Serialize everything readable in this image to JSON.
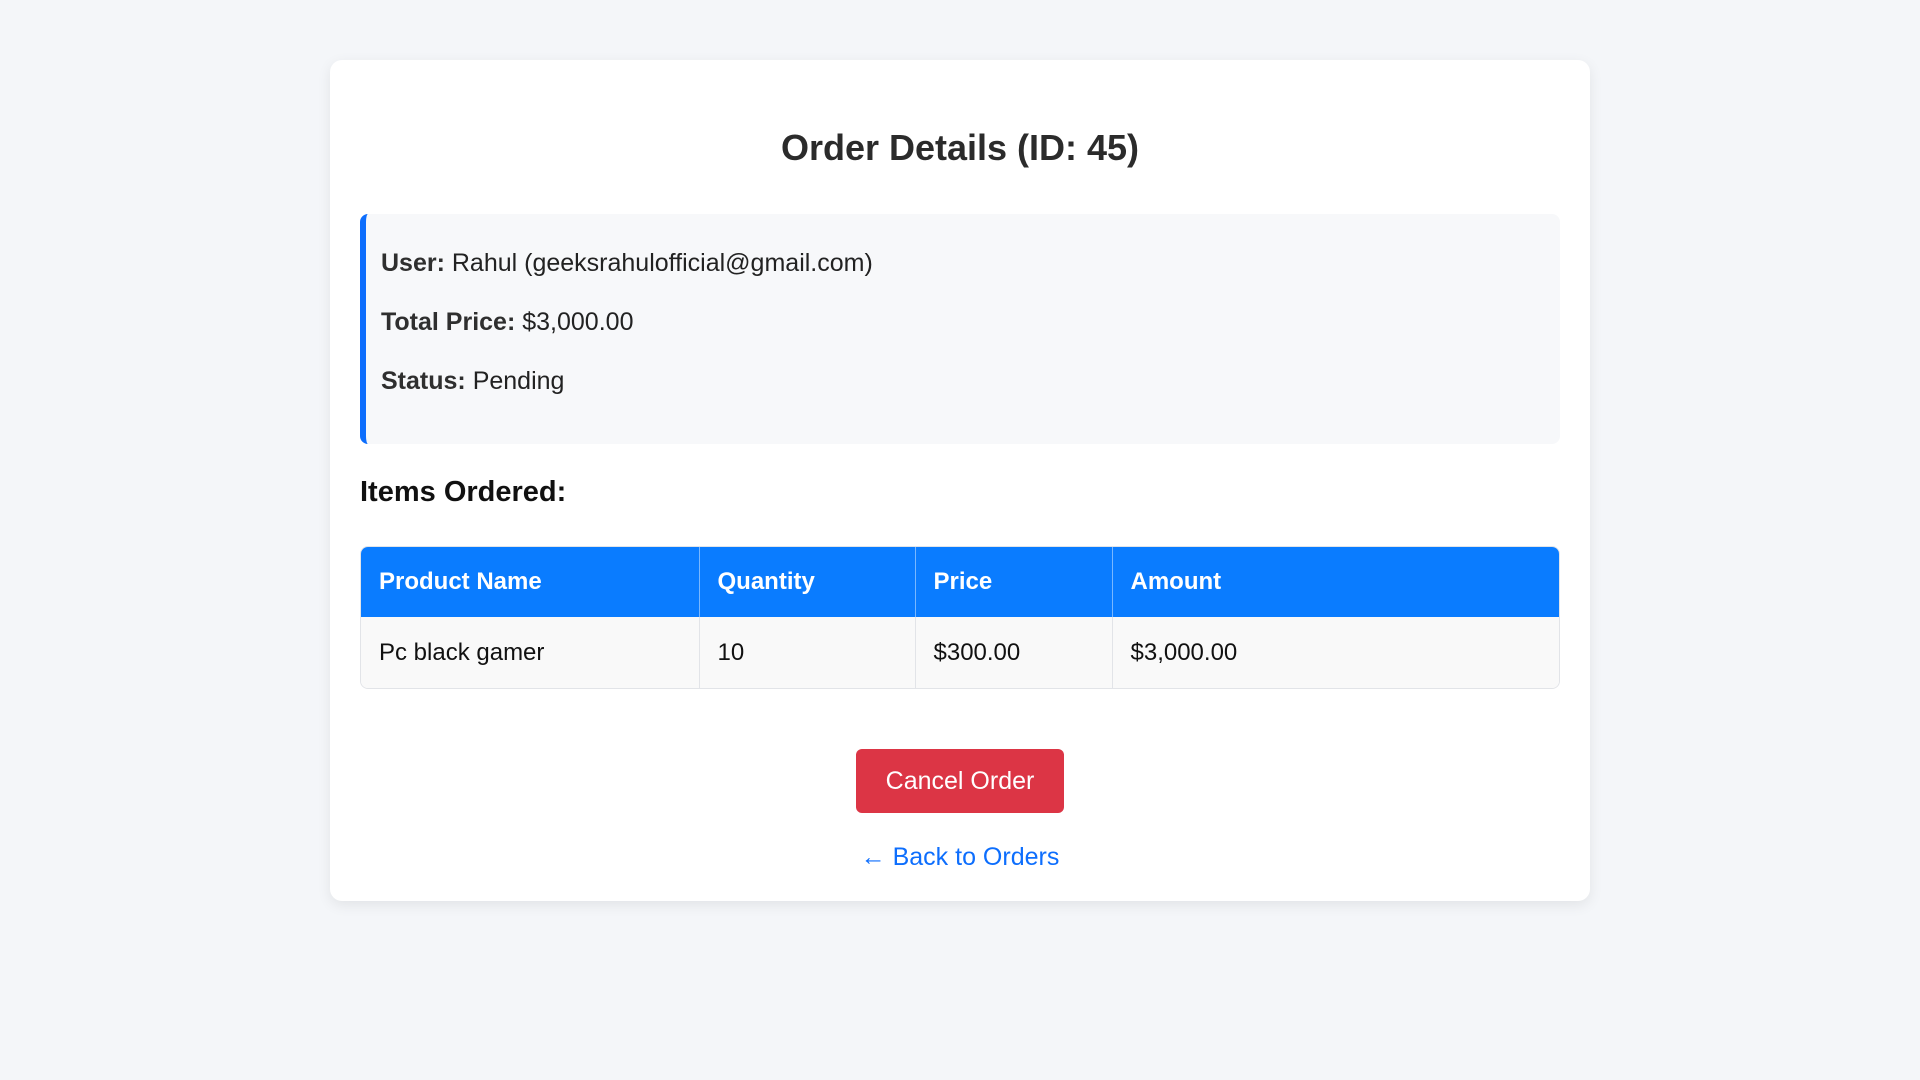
{
  "page": {
    "title": "Order Details (ID: 45)"
  },
  "order_info": {
    "user_label": "User:",
    "user_value": "Rahul (geeksrahulofficial@gmail.com)",
    "total_price_label": "Total Price:",
    "total_price_value": "$3,000.00",
    "status_label": "Status:",
    "status_value": "Pending"
  },
  "items": {
    "heading": "Items Ordered:",
    "columns": [
      "Product Name",
      "Quantity",
      "Price",
      "Amount"
    ],
    "rows": [
      [
        "Pc black gamer",
        "10",
        "$300.00",
        "$3,000.00"
      ]
    ]
  },
  "actions": {
    "cancel_label": "Cancel Order",
    "back_label": "← Back to Orders"
  },
  "colors": {
    "accent": "#0a7cff",
    "danger": "#dc3545",
    "background": "#f4f6f9"
  }
}
